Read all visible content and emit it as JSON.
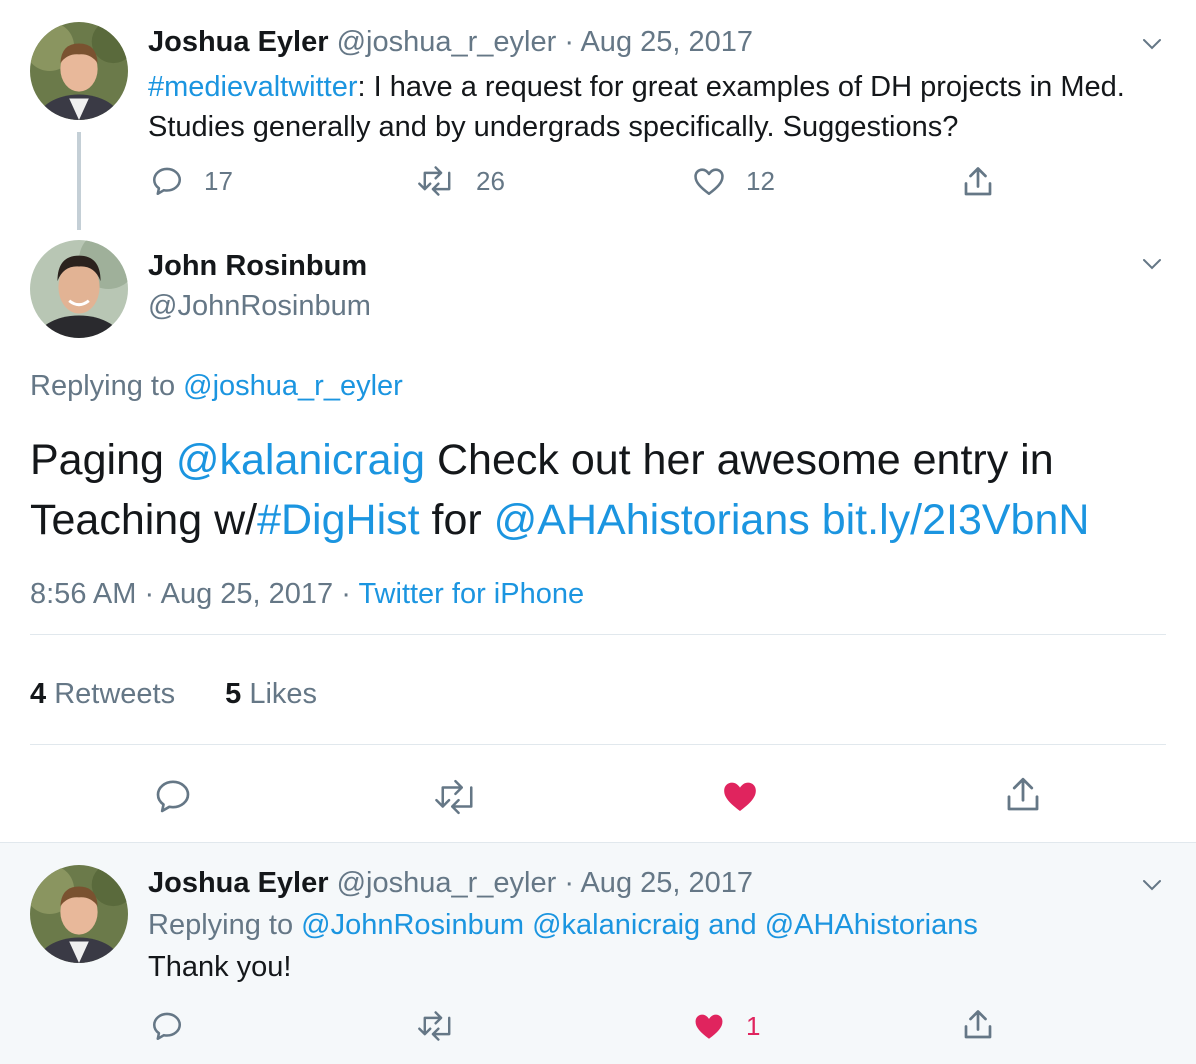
{
  "tweet1": {
    "name": "Joshua Eyler",
    "handle": "@joshua_r_eyler",
    "sep": "·",
    "date": "Aug 25, 2017",
    "hashtag": "#medievaltwitter",
    "text": ": I have a request for great examples of DH projects in Med. Studies generally and by undergrads specifically. Suggestions?",
    "replies": "17",
    "retweets": "26",
    "likes": "12",
    "icons": [
      "avatar",
      "chevron-down-icon",
      "reply-icon",
      "retweet-icon",
      "like-icon",
      "share-icon"
    ]
  },
  "tweet2": {
    "name": "John Rosinbum",
    "handle": "@JohnRosinbum",
    "replying_label": "Replying to ",
    "replying_to": "@joshua_r_eyler",
    "text_1": "Paging ",
    "mention_1": "@kalanicraig",
    "text_2": " Check out her awesome entry in Teaching w/",
    "hashtag": "#DigHist",
    "text_3": " for ",
    "mention_2": "@AHAhistorians",
    "text_4": " ",
    "link": "bit.ly/2I3VbnN",
    "time": "8:56 AM",
    "sep": "·",
    "date": "Aug 25, 2017",
    "source": "Twitter for iPhone",
    "retweets_count": "4",
    "retweets_label": "Retweets",
    "likes_count": "5",
    "likes_label": "Likes",
    "liked": true,
    "like_color": "#e0245e"
  },
  "tweet3": {
    "name": "Joshua Eyler",
    "handle": "@joshua_r_eyler",
    "sep": "·",
    "date": "Aug 25, 2017",
    "replying_label": "Replying to ",
    "mention_1": "@JohnRosinbum",
    "mention_2": "@kalanicraig",
    "and_label": " and ",
    "mention_3": "@AHAhistorians",
    "text": "Thank you!",
    "likes": "1",
    "liked": true
  },
  "colors": {
    "link": "#1b95e0",
    "secondary_text": "#657786",
    "like": "#e0245e",
    "divider": "#e1e8ed",
    "reply_bg": "#f5f8fa"
  }
}
